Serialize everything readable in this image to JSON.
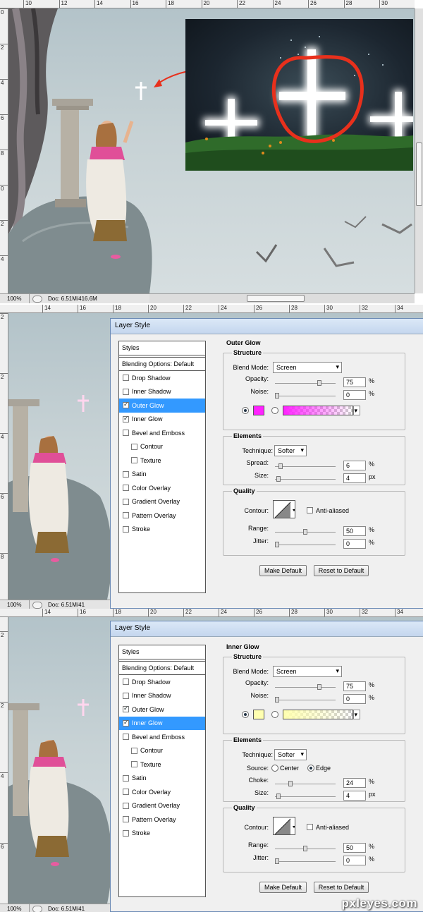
{
  "statusbar": {
    "zoom": "100%",
    "doc_full": "Doc: 6.51M/416.6M",
    "doc_short": "Doc: 6.51M/41"
  },
  "rulers": {
    "panel1_top": [
      "10",
      "12",
      "14",
      "16",
      "18",
      "20",
      "22",
      "24",
      "26",
      "28",
      "30"
    ],
    "panel1_left": [
      "0",
      "2",
      "4",
      "6",
      "8",
      "0",
      "2",
      "4"
    ],
    "panel2_top": [
      "14",
      "16",
      "18",
      "20",
      "22",
      "24",
      "26",
      "28",
      "30",
      "32",
      "34"
    ],
    "panel2_left": [
      "2",
      "2",
      "4",
      "6",
      "8"
    ],
    "panel3_top": [
      "14",
      "16",
      "18",
      "20",
      "22",
      "24",
      "26",
      "28",
      "30",
      "32",
      "34"
    ],
    "panel3_left": [
      "2",
      "2",
      "4",
      "6"
    ]
  },
  "dialog1": {
    "title": "Layer Style",
    "list_header": "Styles",
    "blending": "Blending Options: Default",
    "items": [
      {
        "label": "Drop Shadow",
        "checked": false,
        "selected": false,
        "sub": false
      },
      {
        "label": "Inner Shadow",
        "checked": false,
        "selected": false,
        "sub": false
      },
      {
        "label": "Outer Glow",
        "checked": true,
        "selected": true,
        "sub": false
      },
      {
        "label": "Inner Glow",
        "checked": true,
        "selected": false,
        "sub": false
      },
      {
        "label": "Bevel and Emboss",
        "checked": false,
        "selected": false,
        "sub": false
      },
      {
        "label": "Contour",
        "checked": false,
        "selected": false,
        "sub": true
      },
      {
        "label": "Texture",
        "checked": false,
        "selected": false,
        "sub": true
      },
      {
        "label": "Satin",
        "checked": false,
        "selected": false,
        "sub": false
      },
      {
        "label": "Color Overlay",
        "checked": false,
        "selected": false,
        "sub": false
      },
      {
        "label": "Gradient Overlay",
        "checked": false,
        "selected": false,
        "sub": false
      },
      {
        "label": "Pattern Overlay",
        "checked": false,
        "selected": false,
        "sub": false
      },
      {
        "label": "Stroke",
        "checked": false,
        "selected": false,
        "sub": false
      }
    ],
    "section": "Outer Glow",
    "structure": "Structure",
    "blend_mode_label": "Blend Mode:",
    "blend_mode": "Screen",
    "opacity_label": "Opacity:",
    "opacity": "75",
    "opacity_frac": 0.75,
    "noise_label": "Noise:",
    "noise": "0",
    "noise_frac": 0,
    "pct": "%",
    "px": "px",
    "color": "#ff22ff",
    "grad_from": "#ff22ff",
    "elements": "Elements",
    "technique_label": "Technique:",
    "technique": "Softer",
    "spread_label": "Spread:",
    "spread": "6",
    "spread_frac": 0.06,
    "size_label": "Size:",
    "size": "4",
    "size_frac": 0.02,
    "quality": "Quality",
    "contour_label": "Contour:",
    "antialiased": "Anti-aliased",
    "range_label": "Range:",
    "range": "50",
    "range_frac": 0.5,
    "jitter_label": "Jitter:",
    "jitter": "0",
    "jitter_frac": 0,
    "make_default": "Make Default",
    "reset_default": "Reset to Default"
  },
  "dialog2": {
    "title": "Layer Style",
    "list_header": "Styles",
    "blending": "Blending Options: Default",
    "items": [
      {
        "label": "Drop Shadow",
        "checked": false,
        "selected": false,
        "sub": false
      },
      {
        "label": "Inner Shadow",
        "checked": false,
        "selected": false,
        "sub": false
      },
      {
        "label": "Outer Glow",
        "checked": true,
        "selected": false,
        "sub": false
      },
      {
        "label": "Inner Glow",
        "checked": true,
        "selected": true,
        "sub": false
      },
      {
        "label": "Bevel and Emboss",
        "checked": false,
        "selected": false,
        "sub": false
      },
      {
        "label": "Contour",
        "checked": false,
        "selected": false,
        "sub": true
      },
      {
        "label": "Texture",
        "checked": false,
        "selected": false,
        "sub": true
      },
      {
        "label": "Satin",
        "checked": false,
        "selected": false,
        "sub": false
      },
      {
        "label": "Color Overlay",
        "checked": false,
        "selected": false,
        "sub": false
      },
      {
        "label": "Gradient Overlay",
        "checked": false,
        "selected": false,
        "sub": false
      },
      {
        "label": "Pattern Overlay",
        "checked": false,
        "selected": false,
        "sub": false
      },
      {
        "label": "Stroke",
        "checked": false,
        "selected": false,
        "sub": false
      }
    ],
    "section": "Inner Glow",
    "structure": "Structure",
    "blend_mode_label": "Blend Mode:",
    "blend_mode": "Screen",
    "opacity_label": "Opacity:",
    "opacity": "75",
    "opacity_frac": 0.75,
    "noise_label": "Noise:",
    "noise": "0",
    "noise_frac": 0,
    "pct": "%",
    "px": "px",
    "color": "#ffffb0",
    "grad_from": "#ffffb0",
    "elements": "Elements",
    "technique_label": "Technique:",
    "technique": "Softer",
    "source_label": "Source:",
    "source_center": "Center",
    "source_edge": "Edge",
    "choke_label": "Choke:",
    "choke": "24",
    "choke_frac": 0.24,
    "size_label": "Size:",
    "size": "4",
    "size_frac": 0.02,
    "quality": "Quality",
    "contour_label": "Contour:",
    "antialiased": "Anti-aliased",
    "range_label": "Range:",
    "range": "50",
    "range_frac": 0.5,
    "jitter_label": "Jitter:",
    "jitter": "0",
    "jitter_frac": 0,
    "make_default": "Make Default",
    "reset_default": "Reset to Default"
  },
  "watermark": "pxleyes.com",
  "colors": {
    "selection": "#3399ff",
    "annotation": "#e8301c"
  }
}
